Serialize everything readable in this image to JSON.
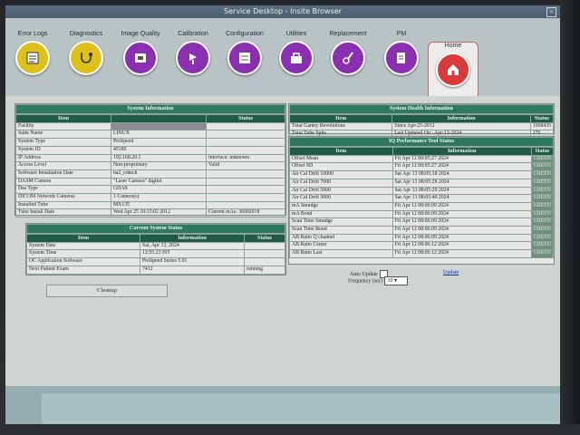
{
  "window": {
    "title": "Service Desktop - Insite Browser"
  },
  "toolbar": {
    "items": [
      {
        "label": "Error Logs",
        "icon": "log-icon",
        "color": "#e0c01a"
      },
      {
        "label": "Diagnostics",
        "icon": "stethoscope-icon",
        "color": "#e0c01a"
      },
      {
        "label": "Image Quality",
        "icon": "image-quality-icon",
        "color": "#8a2fb0"
      },
      {
        "label": "Calibration",
        "icon": "calibration-icon",
        "color": "#8a2fb0"
      },
      {
        "label": "Configuration",
        "icon": "configuration-icon",
        "color": "#8a2fb0"
      },
      {
        "label": "Utilities",
        "icon": "utilities-icon",
        "color": "#8a2fb0"
      },
      {
        "label": "Replacement",
        "icon": "replacement-icon",
        "color": "#8a2fb0"
      },
      {
        "label": "PM",
        "icon": "pm-icon",
        "color": "#8a2fb0"
      },
      {
        "label": "Home",
        "icon": "home-icon",
        "color": "#d93a3a"
      }
    ]
  },
  "system_info": {
    "title": "System Information",
    "col_item": "Item",
    "col_status": "Status",
    "rows": [
      {
        "item": "Facility",
        "value": "",
        "status": "",
        "redacted": true
      },
      {
        "item": "Suite Name",
        "value": "LINUX",
        "status": ""
      },
      {
        "item": "System Type",
        "value": "ProSpeed",
        "status": ""
      },
      {
        "item": "System ID",
        "value": "45185",
        "status": ""
      },
      {
        "item": "IP Address",
        "value": "192.168.20.1",
        "status": "interface: unknown"
      },
      {
        "item": "Access Level",
        "value": "Non-proprietary",
        "status": "Valid"
      },
      {
        "item": "Software Installation Date",
        "value": "ba2_cdtech",
        "status": ""
      },
      {
        "item": "DASM Camera",
        "value": "\"Laser Camera\" digital",
        "status": ""
      },
      {
        "item": "Das Type",
        "value": "GDAS",
        "status": ""
      },
      {
        "item": "DICOM Network Cameras",
        "value": "1 Camera(s)",
        "status": ""
      },
      {
        "item": "Installed Tube",
        "value": "MX135",
        "status": ""
      },
      {
        "item": "Tube Install Date",
        "value": "Wed Apr 25 10:15:02 2012",
        "status": "Current mAs: 36902018"
      }
    ]
  },
  "current_status": {
    "title": "Current System Status",
    "col_item": "Item",
    "col_info": "Information",
    "col_status": "Status",
    "rows": [
      {
        "item": "System Date",
        "info": "Sat, Apr 13, 2024",
        "status": ""
      },
      {
        "item": "System Time",
        "info": "12:55:23 IST",
        "status": ""
      },
      {
        "item": "OC Application Software",
        "info": "ProSpeed Series 5.01",
        "status": ""
      },
      {
        "item": "Next Patient Exam",
        "info": "7412",
        "status": "running"
      }
    ]
  },
  "health": {
    "title": "System Health Information",
    "col_item": "Item",
    "col_info": "Information",
    "col_status": "Status",
    "rows": [
      {
        "item": "Total Gantry Revolutions",
        "info": "Since Apr-25-2012",
        "status": "1068435"
      },
      {
        "item": "Total Tube Spits",
        "info": "Last Updated On : Apr-13-2024",
        "status": "176"
      }
    ]
  },
  "iq": {
    "title": "IQ Performance Tool Status",
    "col_item": "Item",
    "col_info": "Information",
    "col_status": "Status",
    "rows": [
      {
        "item": "Offset Mean",
        "info": "Fri Apr 12 08:05:27 2024",
        "status": "GREEN"
      },
      {
        "item": "Offset SD",
        "info": "Fri Apr 12 08:05:27 2024",
        "status": "GREEN"
      },
      {
        "item": "Air Cal Drift 10000",
        "info": "Sat Apr 13 08:05:18 2024",
        "status": "GREEN"
      },
      {
        "item": "Air Cal Drift 7000",
        "info": "Sat Apr 13 08:05:28 2024",
        "status": "GREEN"
      },
      {
        "item": "Air Cal Drift 5000",
        "info": "Sat Apr 13 08:05:29 2024",
        "status": "GREEN"
      },
      {
        "item": "Air Cal Drift 3000",
        "info": "Sat Apr 13 08:05:40 2024",
        "status": "GREEN"
      },
      {
        "item": "mA Smudge",
        "info": "Fri Apr 12 08:06:09 2024",
        "status": "GREEN"
      },
      {
        "item": "mA Bond",
        "info": "Fri Apr 12 08:06:09 2024",
        "status": "GREEN"
      },
      {
        "item": "Scan Time Smudge",
        "info": "Fri Apr 12 08:06:09 2024",
        "status": "GREEN"
      },
      {
        "item": "Scan Time Bond",
        "info": "Fri Apr 12 08:06:09 2024",
        "status": "GREEN"
      },
      {
        "item": "AB Ratio Q channel",
        "info": "Fri Apr 12 08:06:09 2024",
        "status": "GREEN"
      },
      {
        "item": "AB Ratio Center",
        "info": "Fri Apr 12 08:06:12 2024",
        "status": "GREEN"
      },
      {
        "item": "AB Ratio Last",
        "info": "Fri Apr 12 08:06:12 2024",
        "status": "GREEN"
      }
    ]
  },
  "controls": {
    "auto_update_label": "Auto Update",
    "update_link": "Update",
    "frequency_label": "Frequency (sec)",
    "frequency_value": "10",
    "cleanup_label": "Cleanup"
  }
}
